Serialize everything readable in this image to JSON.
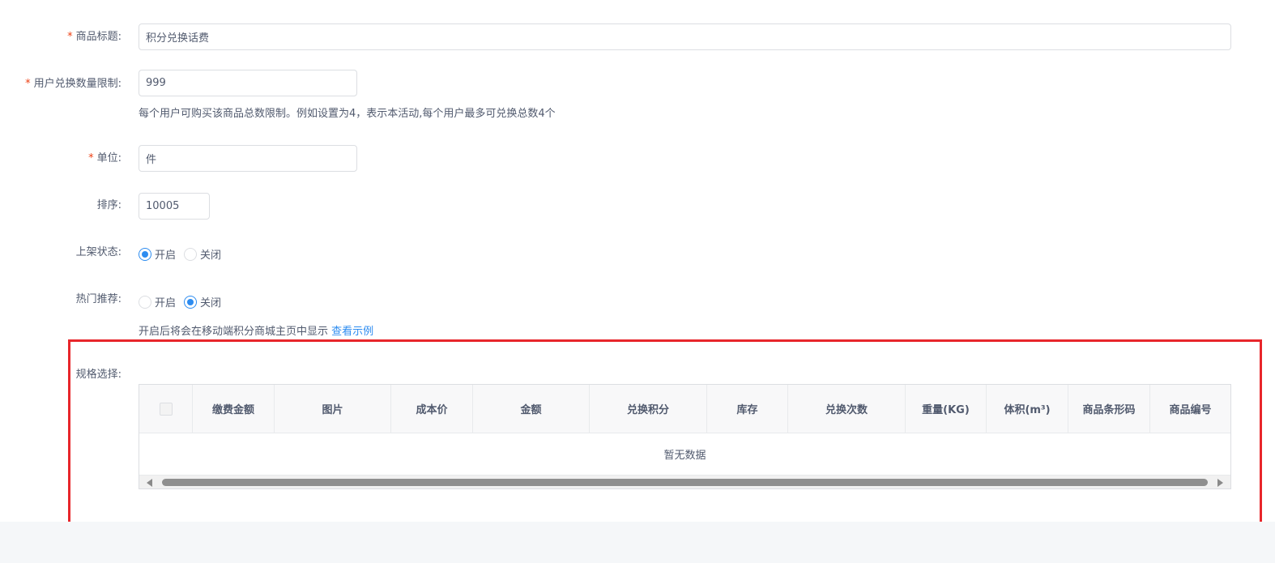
{
  "form": {
    "title": {
      "required_mark": "*",
      "label": "商品标题:",
      "value": "积分兑换话费"
    },
    "limit": {
      "required_mark": "*",
      "label": "用户兑换数量限制:",
      "value": "999",
      "help": "每个用户可购买该商品总数限制。例如设置为4，表示本活动,每个用户最多可兑换总数4个"
    },
    "unit": {
      "required_mark": "*",
      "label": "单位:",
      "value": "件"
    },
    "sort": {
      "label": "排序:",
      "value": "10005"
    },
    "shelf_status": {
      "label": "上架状态:",
      "options": [
        "开启",
        "关闭"
      ],
      "selected": "开启"
    },
    "hot_recommend": {
      "label": "热门推荐:",
      "options": [
        "开启",
        "关闭"
      ],
      "selected": "关闭",
      "help": "开启后将会在移动端积分商城主页中显示",
      "help_link": "查看示例"
    },
    "spec": {
      "label": "规格选择:",
      "columns": [
        "缴费金额",
        "图片",
        "成本价",
        "金额",
        "兑换积分",
        "库存",
        "兑换次数",
        "重量(KG)",
        "体积(m³)",
        "商品条形码",
        "商品编号"
      ],
      "empty_text": "暂无数据"
    }
  },
  "colors": {
    "accent": "#2d8cf0",
    "required": "#ed4014",
    "highlight": "#e8262b"
  }
}
